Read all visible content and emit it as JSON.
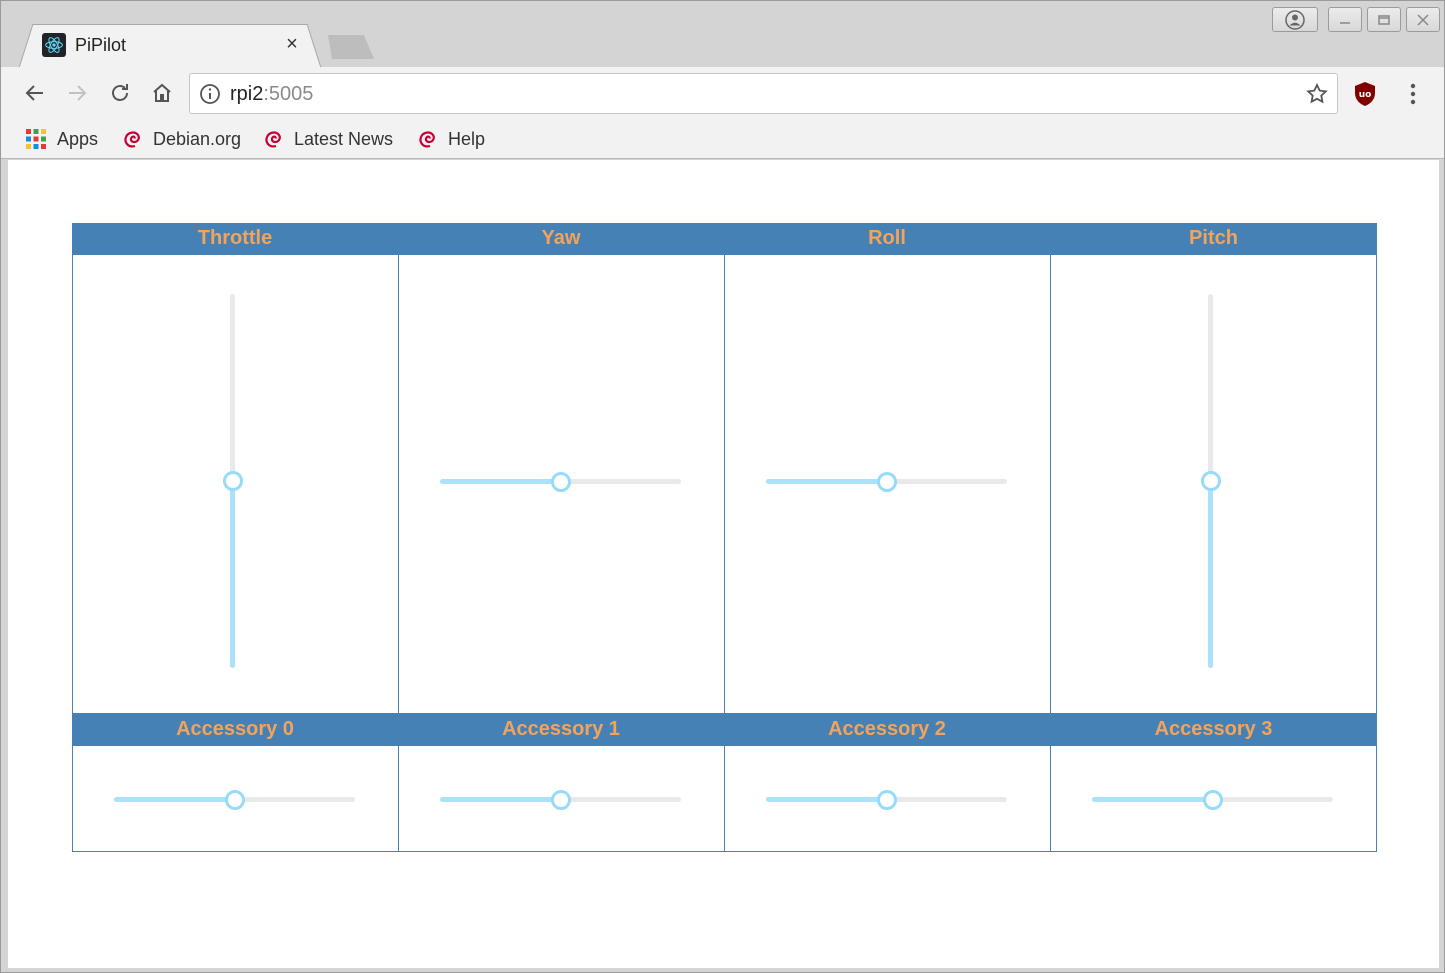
{
  "browser": {
    "tab": {
      "title": "PiPilot",
      "close_glyph": "×",
      "favicon": "react-logo-icon"
    },
    "window_controls": [
      "user-icon",
      "minimize-icon",
      "maximize-icon",
      "close-icon"
    ],
    "toolbar": {
      "back_icon": "back-arrow-icon",
      "forward_icon": "forward-arrow-icon",
      "reload_icon": "reload-icon",
      "home_icon": "home-icon",
      "url_host": "rpi2",
      "url_port": ":5005",
      "star_icon": "star-icon",
      "extension_icon": "ublock-origin-icon",
      "menu_icon": "kebab-menu-icon"
    },
    "bookmarks": [
      {
        "label": "Apps",
        "icon": "apps-grid-icon"
      },
      {
        "label": "Debian.org",
        "icon": "debian-swirl-icon"
      },
      {
        "label": "Latest News",
        "icon": "debian-swirl-icon"
      },
      {
        "label": "Help",
        "icon": "debian-swirl-icon"
      }
    ]
  },
  "page": {
    "colors": {
      "header_bg": "#4581b5",
      "header_text": "#f3a35a",
      "track": "#abe1fa",
      "rail": "#e9e9e9",
      "handle_border": "#96dbfa"
    },
    "controls": [
      {
        "label": "Throttle",
        "orientation": "vertical",
        "value": 0.5
      },
      {
        "label": "Yaw",
        "orientation": "horizontal",
        "value": 0.5
      },
      {
        "label": "Roll",
        "orientation": "horizontal",
        "value": 0.5
      },
      {
        "label": "Pitch",
        "orientation": "vertical",
        "value": 0.5
      }
    ],
    "accessories": [
      {
        "label": "Accessory 0",
        "orientation": "horizontal",
        "value": 0.5
      },
      {
        "label": "Accessory 1",
        "orientation": "horizontal",
        "value": 0.5
      },
      {
        "label": "Accessory 2",
        "orientation": "horizontal",
        "value": 0.5
      },
      {
        "label": "Accessory 3",
        "orientation": "horizontal",
        "value": 0.5
      }
    ]
  }
}
